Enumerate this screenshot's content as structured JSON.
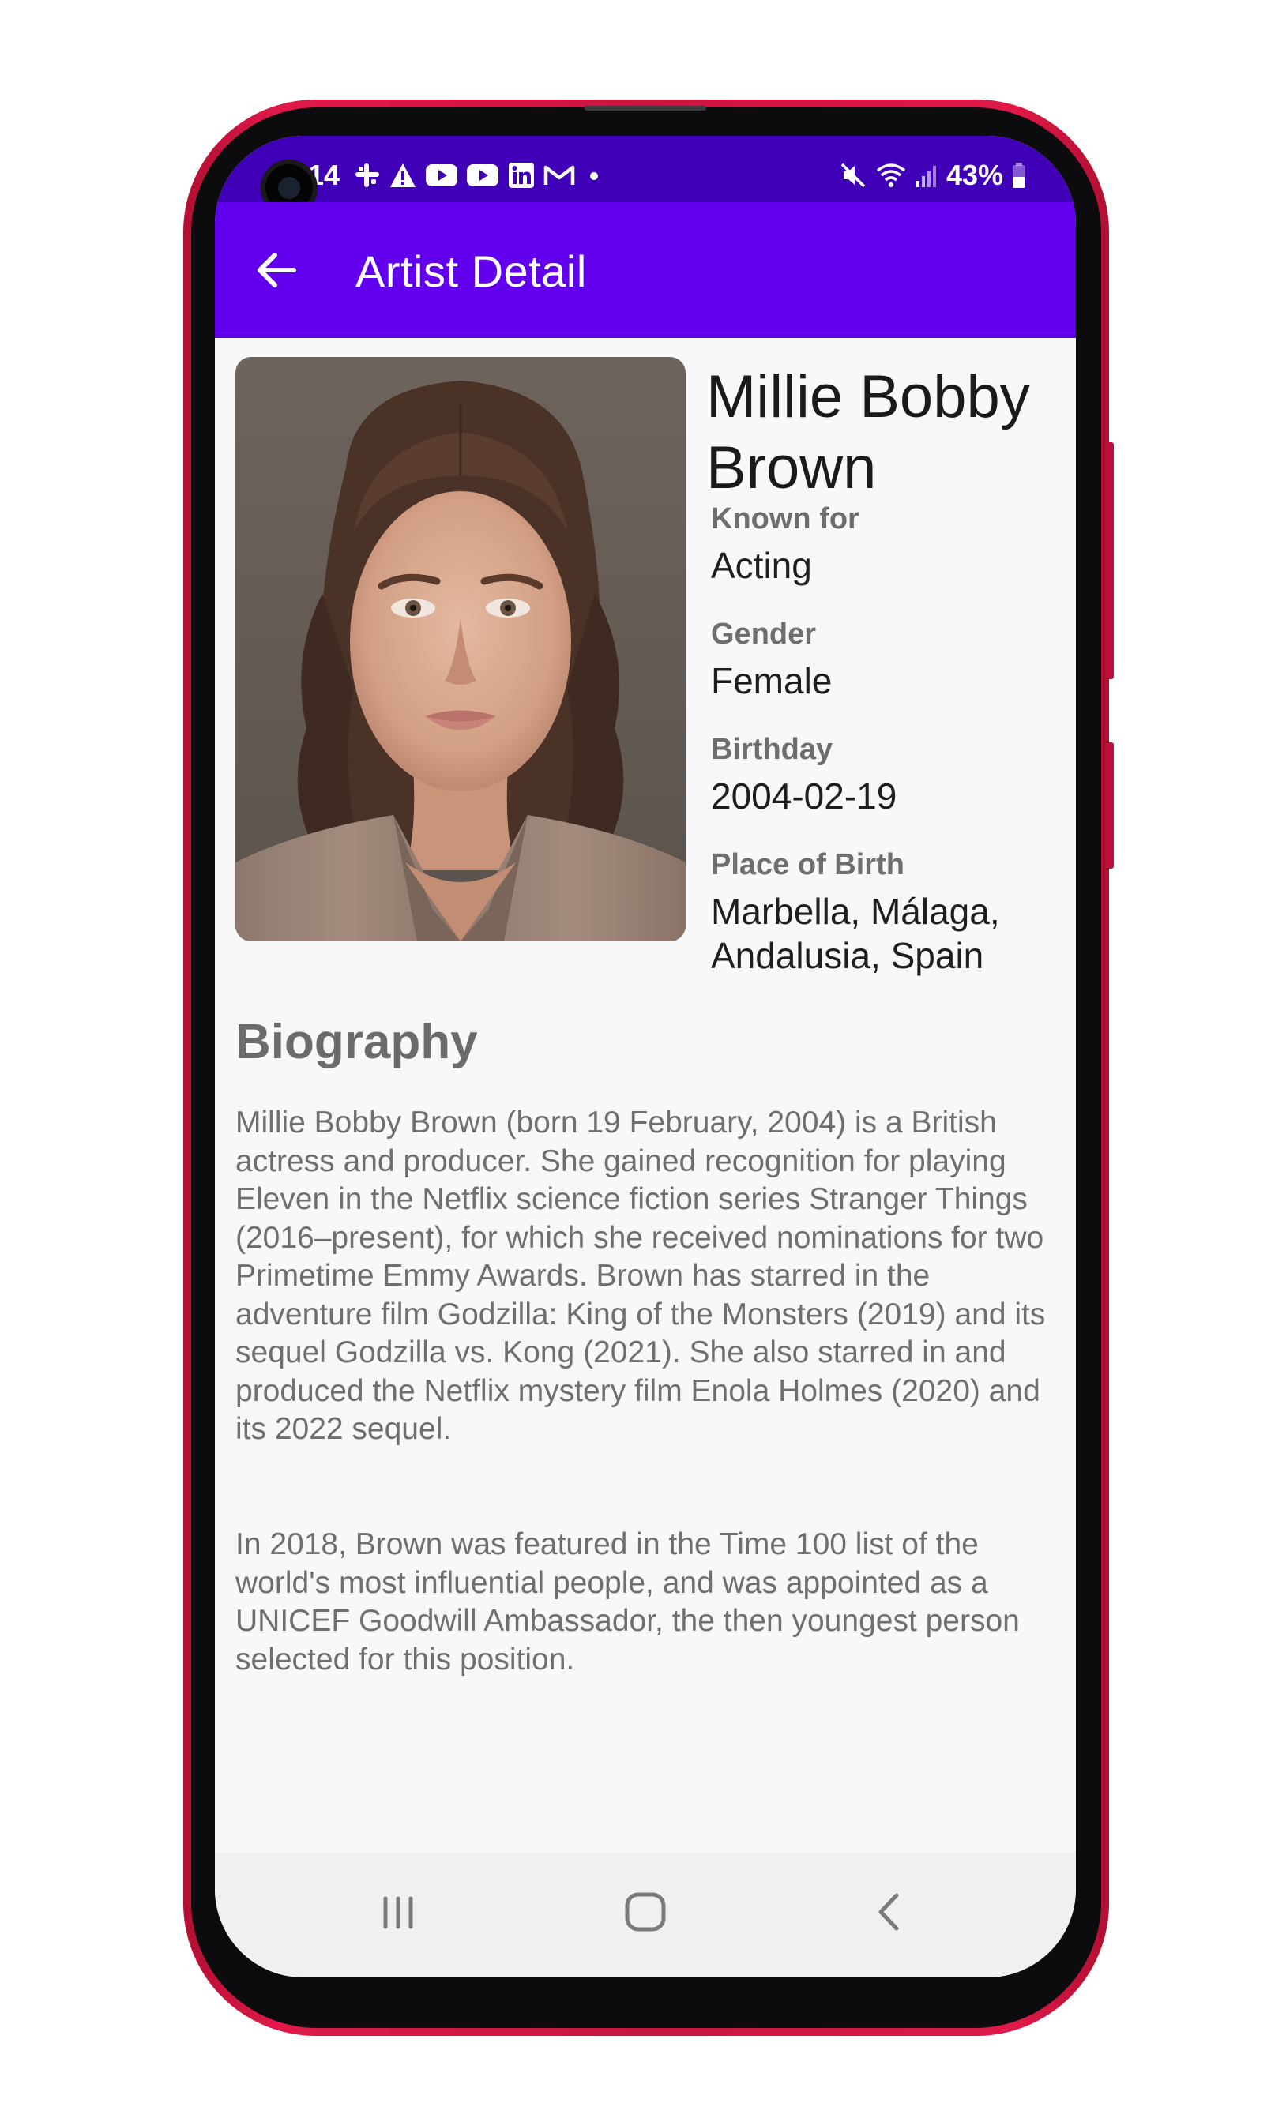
{
  "status_bar": {
    "time": "14",
    "battery": "43%",
    "left_icons": [
      "slack-icon",
      "warning-icon",
      "youtube-icon",
      "youtube-icon",
      "linkedin-icon",
      "gmail-icon",
      "notification-dot-icon"
    ],
    "right_icons": [
      "mute-icon",
      "wifi-icon",
      "signal-icon",
      "battery-icon"
    ]
  },
  "app_bar": {
    "title": "Artist Detail",
    "back_icon": "arrow-left-icon"
  },
  "artist": {
    "name": "Millie Bobby Brown",
    "fields": [
      {
        "label": "Known for",
        "value": "Acting"
      },
      {
        "label": "Gender",
        "value": "Female"
      },
      {
        "label": "Birthday",
        "value": "2004-02-19"
      },
      {
        "label": "Place of Birth",
        "value": "Marbella, Málaga, Andalusia, Spain"
      }
    ]
  },
  "biography": {
    "heading": "Biography",
    "paragraphs": [
      "Millie Bobby Brown (born 19 February, 2004) is a British actress and producer. She gained recognition for playing Eleven in the Netflix science fiction series Stranger Things (2016–present), for which she received nominations for two Primetime Emmy Awards. Brown has starred in the adventure film Godzilla: King of the Monsters (2019) and its sequel Godzilla vs. Kong (2021). She also starred in and produced the Netflix mystery film Enola Holmes (2020) and its 2022 sequel.",
      "In 2018, Brown was featured in the Time 100 list of the world's most influential people, and was appointed as a UNICEF Goodwill Ambassador, the then youngest person selected for this position."
    ]
  },
  "nav_bar": {
    "buttons": [
      "recent-apps-icon",
      "home-icon",
      "back-icon"
    ]
  },
  "colors": {
    "status_bar": "#4000b7",
    "app_bar": "#6200ee",
    "phone_frame": "#d4163f",
    "background": "#f8f8f8"
  }
}
